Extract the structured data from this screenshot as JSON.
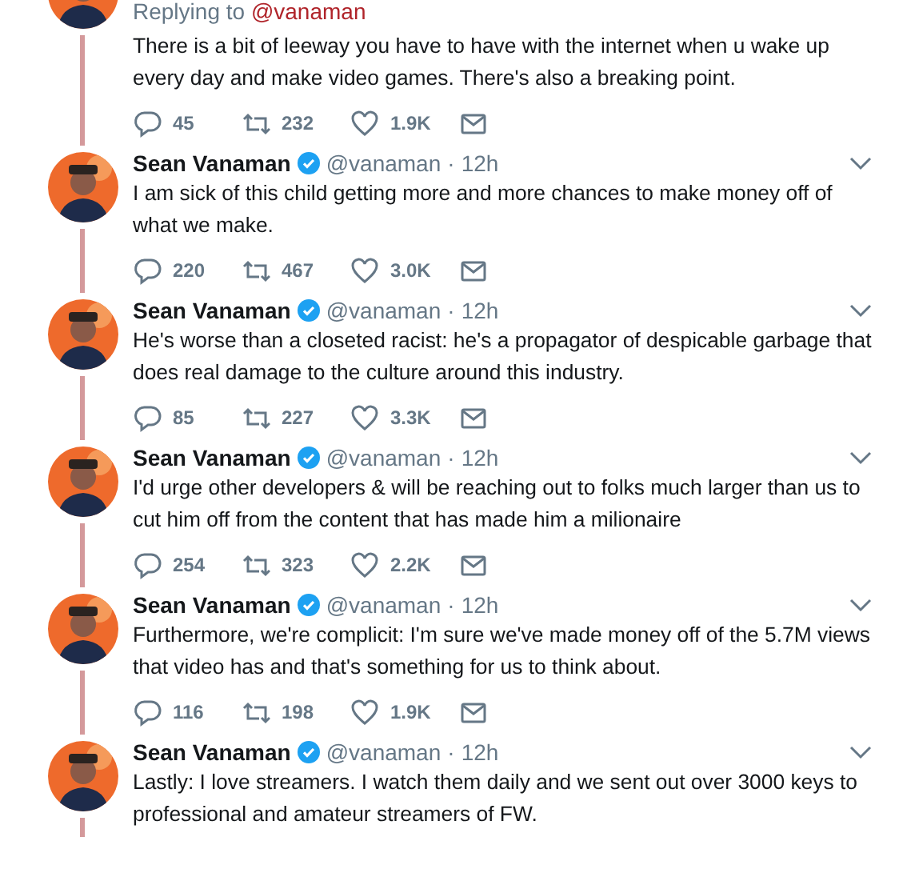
{
  "tweets": [
    {
      "kind": "reply",
      "replying_label": "Replying to",
      "replying_handle": "@vanaman",
      "text": "There is a bit of leeway you have to have with the internet when u wake up every day and make video games. There's also a breaking point.",
      "replies": "45",
      "retweets": "232",
      "likes": "1.9K"
    },
    {
      "kind": "full",
      "name": "Sean Vanaman",
      "verified": true,
      "handle": "@vanaman",
      "separator": "·",
      "time": "12h",
      "text": "I am sick of this child getting more and more chances to make money off of what we make.",
      "replies": "220",
      "retweets": "467",
      "likes": "3.0K"
    },
    {
      "kind": "full",
      "name": "Sean Vanaman",
      "verified": true,
      "handle": "@vanaman",
      "separator": "·",
      "time": "12h",
      "text": "He's worse than a closeted racist: he's a propagator of despicable garbage that does real damage to the culture around this industry.",
      "replies": "85",
      "retweets": "227",
      "likes": "3.3K"
    },
    {
      "kind": "full",
      "name": "Sean Vanaman",
      "verified": true,
      "handle": "@vanaman",
      "separator": "·",
      "time": "12h",
      "text": "I'd urge other developers & will be reaching out to folks much larger than us to cut him off from the content that has made him a milionaire",
      "replies": "254",
      "retweets": "323",
      "likes": "2.2K"
    },
    {
      "kind": "full",
      "name": "Sean Vanaman",
      "verified": true,
      "handle": "@vanaman",
      "separator": "·",
      "time": "12h",
      "text": "Furthermore, we're complicit: I'm sure we've made money off of the 5.7M views that video has and that's something for us to think about.",
      "replies": "116",
      "retweets": "198",
      "likes": "1.9K"
    },
    {
      "kind": "full",
      "name": "Sean Vanaman",
      "verified": true,
      "handle": "@vanaman",
      "separator": "·",
      "time": "12h",
      "text": "Lastly: I love streamers. I watch them daily and we sent out over 3000 keys to professional and amateur streamers of FW."
    }
  ]
}
